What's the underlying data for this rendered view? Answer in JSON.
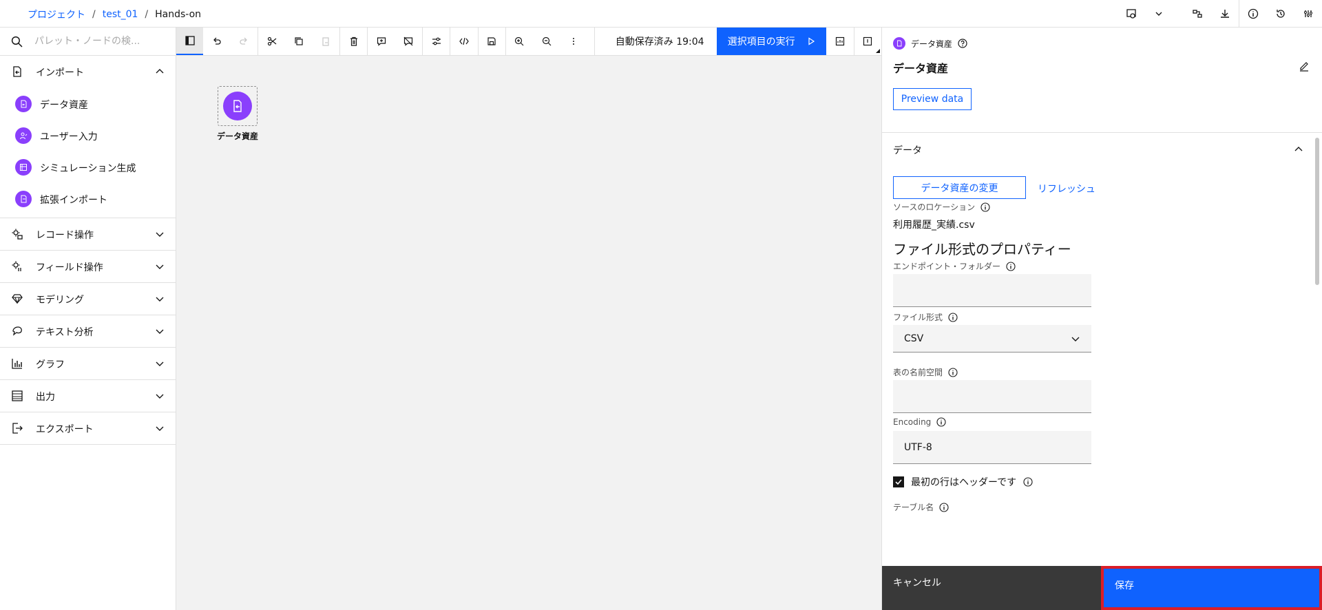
{
  "breadcrumb": {
    "project": "プロジェクト",
    "folder": "test_01",
    "current": "Hands-on",
    "separator": "/"
  },
  "palette": {
    "search_placeholder": "パレット・ノードの検...",
    "categories": [
      {
        "label": "インポート",
        "icon": "import-icon",
        "expanded": true
      },
      {
        "label": "レコード操作",
        "icon": "record-ops-icon"
      },
      {
        "label": "フィールド操作",
        "icon": "field-ops-icon"
      },
      {
        "label": "モデリング",
        "icon": "modeling-icon"
      },
      {
        "label": "テキスト分析",
        "icon": "text-analysis-icon"
      },
      {
        "label": "グラフ",
        "icon": "graph-icon"
      },
      {
        "label": "出力",
        "icon": "output-icon"
      },
      {
        "label": "エクスポート",
        "icon": "export-icon"
      }
    ],
    "import_items": [
      {
        "label": "データ資産",
        "icon": "data-asset-icon"
      },
      {
        "label": "ユーザー入力",
        "icon": "user-input-icon"
      },
      {
        "label": "シミュレーション生成",
        "icon": "simulation-icon"
      },
      {
        "label": "拡張インポート",
        "icon": "extended-import-icon"
      }
    ]
  },
  "toolbar": {
    "autosave": "自動保存済み 19:04",
    "run_label": "選択項目の実行"
  },
  "canvas": {
    "node_label": "データ資産"
  },
  "panel": {
    "type_label": "データ資産",
    "title": "データ資産",
    "preview_label": "Preview data",
    "section_label": "データ",
    "change_label": "データ資産の変更",
    "refresh_label": "リフレッシュ",
    "source_location_label": "ソースのロケーション",
    "source_location_value": "利用履歴_実績.csv",
    "props_heading": "ファイル形式のプロパティー",
    "endpoint_label": "エンドポイント・フォルダー",
    "endpoint_value": "",
    "file_format_label": "ファイル形式",
    "file_format_value": "CSV",
    "namespace_label": "表の名前空間",
    "namespace_value": "",
    "encoding_label": "Encoding",
    "encoding_value": "UTF-8",
    "header_checkbox_label": "最初の行はヘッダーです",
    "header_checked": true,
    "table_name_label": "テーブル名"
  },
  "footer": {
    "cancel_label": "キャンセル",
    "save_label": "保存"
  },
  "colors": {
    "accent": "#0f62fe",
    "node_purple": "#8a3ffc",
    "highlight": "#da1e28"
  }
}
